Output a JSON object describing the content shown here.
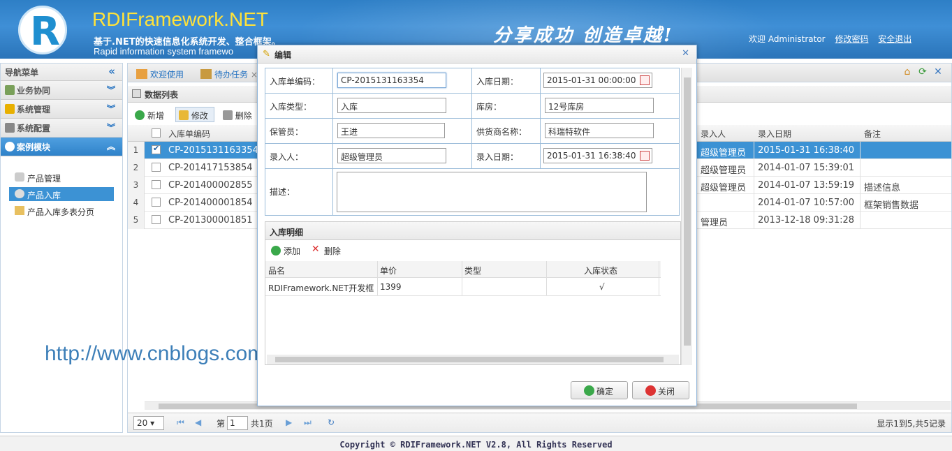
{
  "header": {
    "brand": "RDIFramework.NET",
    "subtitle_cn": "基于.NET的快速信息化系统开发、整合框架。",
    "subtitle_en": "Rapid information system framewo",
    "slogan": "分享成功  创造卓越!",
    "welcome": "欢迎 Administrator",
    "change_password": "修改密码",
    "logout": "安全退出",
    "logo_letter": "R"
  },
  "sidebar": {
    "title": "导航菜单",
    "sections": [
      {
        "label": "业务协同"
      },
      {
        "label": "系统管理"
      },
      {
        "label": "系统配置"
      },
      {
        "label": "案例模块"
      }
    ],
    "items": [
      {
        "label": "产品管理"
      },
      {
        "label": "产品入库"
      },
      {
        "label": "产品入库多表分页"
      }
    ]
  },
  "tabs": [
    {
      "label": "欢迎使用"
    },
    {
      "label": "待办任务"
    }
  ],
  "grid": {
    "title": "数据列表",
    "toolbar": {
      "add": "新增",
      "edit": "修改",
      "delete": "删除"
    },
    "columns": {
      "code": "入库单编码",
      "entry_user": "录入人",
      "entry_date": "录入日期",
      "remark": "备注"
    },
    "rows": [
      {
        "num": "1",
        "code": "CP-2015131163354",
        "entry_user": "超级管理员",
        "entry_date": "2015-01-31 16:38:40",
        "remark": ""
      },
      {
        "num": "2",
        "code": "CP-201417153854",
        "entry_user": "超级管理员",
        "entry_date": "2014-01-07 15:39:01",
        "remark": ""
      },
      {
        "num": "3",
        "code": "CP-201400002855",
        "entry_user": "超级管理员",
        "entry_date": "2014-01-07 13:59:19",
        "remark": "描述信息"
      },
      {
        "num": "4",
        "code": "CP-201400001854",
        "entry_user": "",
        "entry_date": "2014-01-07 10:57:00",
        "remark": "框架销售数据"
      },
      {
        "num": "5",
        "code": "CP-201300001851",
        "entry_user": "管理员",
        "entry_date": "2013-12-18 09:31:28",
        "remark": ""
      }
    ]
  },
  "pager": {
    "page_size": "20",
    "page_prefix": "第",
    "page_value": "1",
    "page_total": "共1页",
    "info": "显示1到5,共5记录"
  },
  "footer": "Copyright © RDIFramework.NET V2.8, All Rights Reserved",
  "watermark": "http://www.cnblogs.com/huyong/",
  "dialog": {
    "title": "编辑",
    "fields": {
      "code_label": "入库单编码：",
      "code_value": "CP-2015131163354",
      "date_label": "入库日期：",
      "date_value": "2015-01-31 00:00:00",
      "type_label": "入库类型：",
      "type_value": "入库",
      "warehouse_label": "库房：",
      "warehouse_value": "12号库房",
      "keeper_label": "保管员：",
      "keeper_value": "王进",
      "supplier_label": "供货商名称：",
      "supplier_value": "科瑞特软件",
      "entry_user_label": "录入人：",
      "entry_user_value": "超级管理员",
      "entry_date_label": "录入日期：",
      "entry_date_value": "2015-01-31 16:38:40",
      "desc_label": "描述："
    },
    "detail": {
      "title": "入库明细",
      "add": "添加",
      "delete": "删除",
      "columns": {
        "name": "品名",
        "price": "单价",
        "type": "类型",
        "status": "入库状态"
      },
      "rows": [
        {
          "name": "RDIFramework.NET开发框",
          "price": "1399",
          "type": "",
          "status": "√"
        }
      ]
    },
    "ok": "确定",
    "close": "关闭"
  },
  "colors": {
    "accent": "#3c92d4",
    "header": "#2e7fc6",
    "brand": "#ffe23a"
  }
}
